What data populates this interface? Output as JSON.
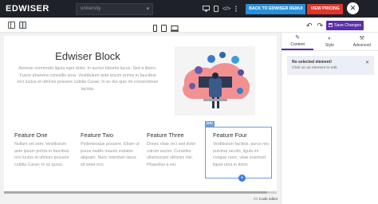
{
  "header": {
    "brand": "EDWISER",
    "select_value": "university",
    "back_button": "BACK TO EDWISER REMUI",
    "pricing_button": "VIEW PRICING"
  },
  "toolbar": {
    "save_label": "Save Changes"
  },
  "hero": {
    "title": "Edwiser Block",
    "text": "Aenean commodo ligula eget dolor. In auctor lobortis lacus. Sed a libero. Fusce pharetra convallis urna. Vestibulum ante ipsum primis in faucibus orci luctus et ultrices posuere cubilia Curae; In ac dui quis mi consectetuer lacinia."
  },
  "features": [
    {
      "title": "Feature One",
      "text": "Nullam vel sem. Vestibulum ante ipsum primis in faucibus orci luctus et ultrices posuere cubilia Curae; In ac purus."
    },
    {
      "title": "Feature Two",
      "text": "Pellentesque posuere. Etiam ut purus mattis mauris sodales aliquam. Nunc interdum lacus sit amet orci."
    },
    {
      "title": "Feature Three",
      "text": "Donec vitae orci sed dolor rutrum auctor. Curabitur ullamcorper ultricies nisi. Phasellus a est."
    },
    {
      "title": "Feature Four",
      "text": "Vestibulum facilisis, purus nec pulvinar iaculis, ligula mi congue nunc, vitae euismod ligula urna in dolor."
    }
  ],
  "selected_tag": "DIV",
  "code_editor_label": "<> Code editor",
  "panel": {
    "tabs": [
      {
        "label": "Content",
        "icon": "brush-icon"
      },
      {
        "label": "Style",
        "icon": "palette-icon"
      },
      {
        "label": "Advanced",
        "icon": "wrench-icon"
      }
    ],
    "notice_title": "No selected element!",
    "notice_text": "Click on an element to edit."
  },
  "colors": {
    "topbar": "#1e2127",
    "back_button": "#2b8fd8",
    "pricing_button": "#e0352b",
    "save_button": "#5a2fa8",
    "selection": "#6a9fd4"
  }
}
